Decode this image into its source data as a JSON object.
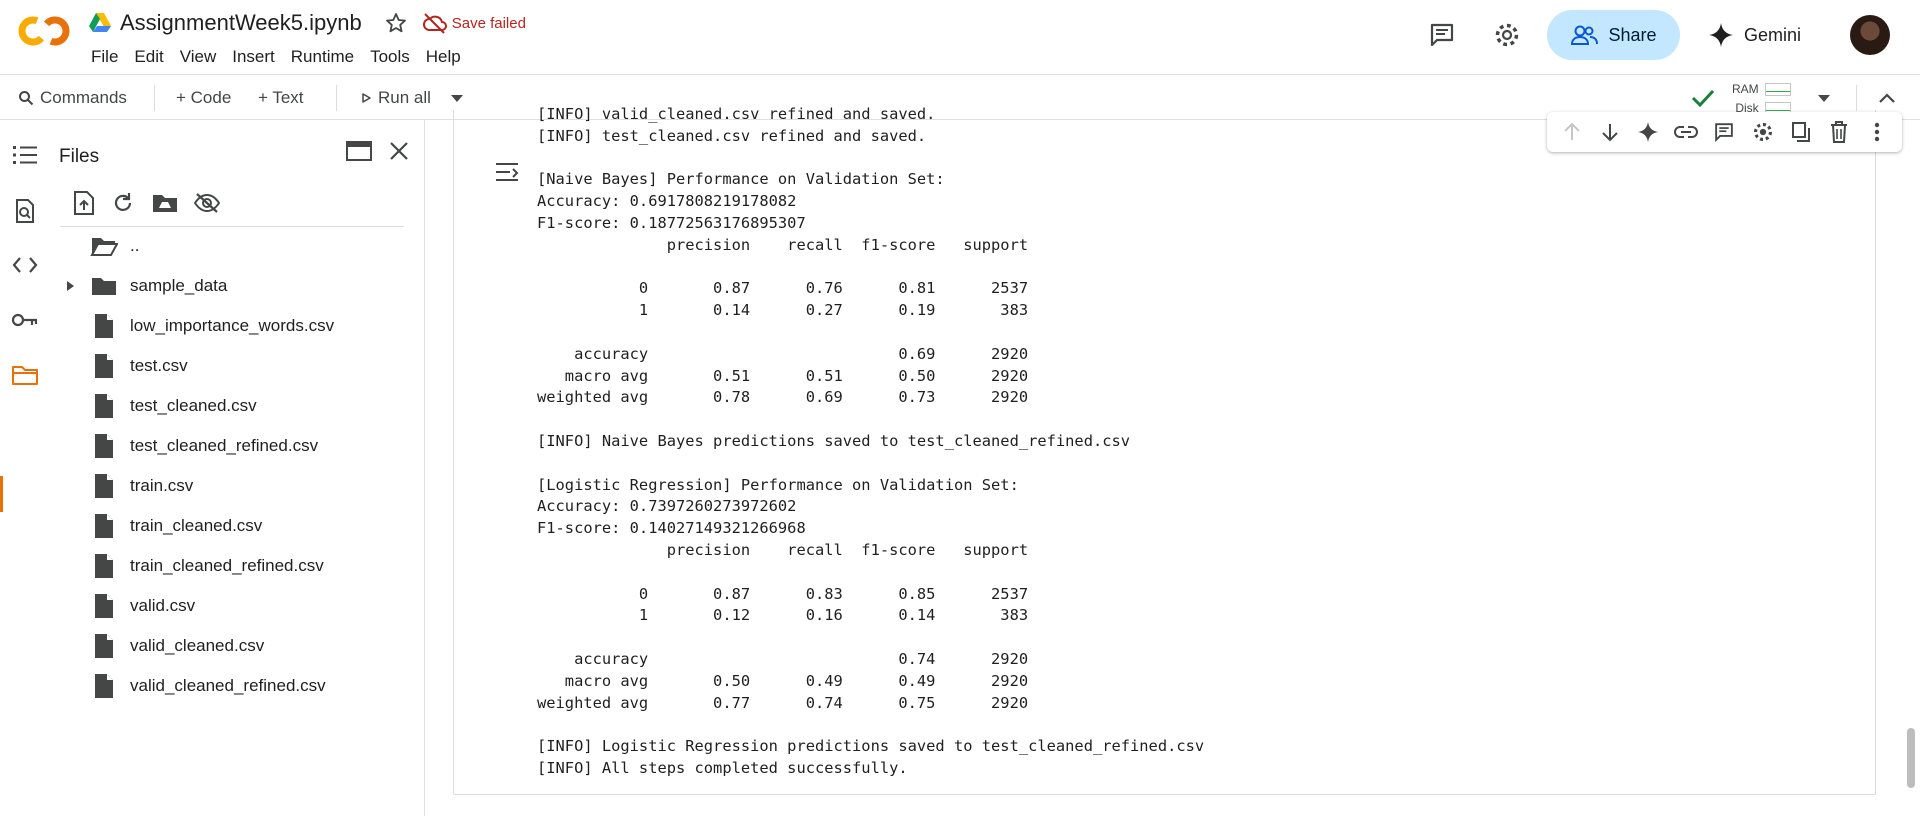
{
  "header": {
    "logo_text": "CO",
    "notebook_title": "AssignmentWeek5.ipynb",
    "save_status": "Save failed",
    "menu": [
      "File",
      "Edit",
      "View",
      "Insert",
      "Runtime",
      "Tools",
      "Help"
    ],
    "share_label": "Share",
    "gemini_label": "Gemini"
  },
  "toolbar": {
    "commands_label": "Commands",
    "code_label": "+ Code",
    "text_label": "+ Text",
    "run_all_label": "Run all",
    "ram_label": "RAM",
    "disk_label": "Disk"
  },
  "files_panel": {
    "title": "Files",
    "items": [
      {
        "name": "..",
        "type": "parent-folder"
      },
      {
        "name": "sample_data",
        "type": "folder"
      },
      {
        "name": "low_importance_words.csv",
        "type": "file"
      },
      {
        "name": "test.csv",
        "type": "file"
      },
      {
        "name": "test_cleaned.csv",
        "type": "file"
      },
      {
        "name": "test_cleaned_refined.csv",
        "type": "file"
      },
      {
        "name": "train.csv",
        "type": "file"
      },
      {
        "name": "train_cleaned.csv",
        "type": "file"
      },
      {
        "name": "train_cleaned_refined.csv",
        "type": "file"
      },
      {
        "name": "valid.csv",
        "type": "file"
      },
      {
        "name": "valid_cleaned.csv",
        "type": "file"
      },
      {
        "name": "valid_cleaned_refined.csv",
        "type": "file"
      }
    ]
  },
  "output": {
    "lines": [
      "[INFO] valid_cleaned.csv refined and saved.",
      "[INFO] test_cleaned.csv refined and saved.",
      "",
      "[Naive Bayes] Performance on Validation Set:",
      "Accuracy: 0.6917808219178082",
      "F1-score: 0.18772563176895307",
      "              precision    recall  f1-score   support",
      "",
      "           0       0.87      0.76      0.81      2537",
      "           1       0.14      0.27      0.19       383",
      "",
      "    accuracy                           0.69      2920",
      "   macro avg       0.51      0.51      0.50      2920",
      "weighted avg       0.78      0.69      0.73      2920",
      "",
      "[INFO] Naive Bayes predictions saved to test_cleaned_refined.csv",
      "",
      "[Logistic Regression] Performance on Validation Set:",
      "Accuracy: 0.7397260273972602",
      "F1-score: 0.14027149321266968",
      "              precision    recall  f1-score   support",
      "",
      "           0       0.87      0.83      0.85      2537",
      "           1       0.12      0.16      0.14       383",
      "",
      "    accuracy                           0.74      2920",
      "   macro avg       0.50      0.49      0.49      2920",
      "weighted avg       0.77      0.74      0.75      2920",
      "",
      "[INFO] Logistic Regression predictions saved to test_cleaned_refined.csv",
      "[INFO] All steps completed successfully."
    ]
  },
  "colors": {
    "accent_orange": "#e8710a",
    "share_bg": "#c2e7ff",
    "save_failed": "#b3261e",
    "ok_green": "#34a853"
  }
}
